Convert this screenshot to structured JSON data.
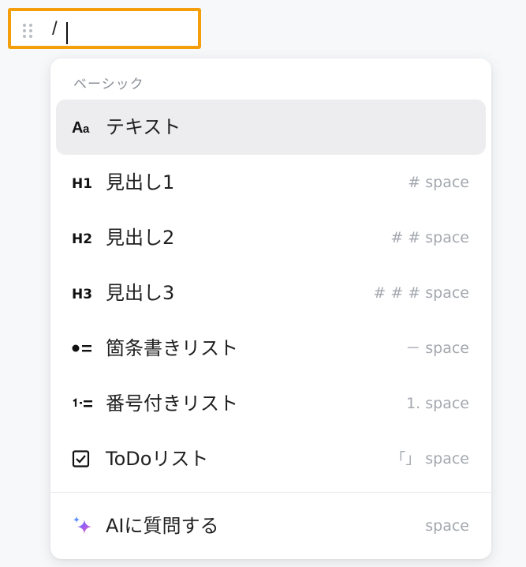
{
  "editor": {
    "input_value": "/"
  },
  "menu": {
    "section_label": "ベーシック",
    "items": [
      {
        "icon": "text-icon",
        "label": "テキスト",
        "shortcut": ""
      },
      {
        "icon": "heading1-icon",
        "label": "見出し1",
        "shortcut": "# space"
      },
      {
        "icon": "heading2-icon",
        "label": "見出し2",
        "shortcut": "# # space"
      },
      {
        "icon": "heading3-icon",
        "label": "見出し3",
        "shortcut": "# # # space"
      },
      {
        "icon": "bulleted-list-icon",
        "label": "箇条書きリスト",
        "shortcut": "－ space"
      },
      {
        "icon": "numbered-list-icon",
        "label": "番号付きリスト",
        "shortcut": "1. space"
      },
      {
        "icon": "checkbox-icon",
        "label": "ToDoリスト",
        "shortcut": "「」 space"
      }
    ],
    "ai_item": {
      "icon": "sparkle-icon",
      "label": "AIに質問する",
      "shortcut": "space"
    }
  },
  "colors": {
    "highlight_border": "#f59e0b",
    "active_item_bg": "#ededef"
  }
}
